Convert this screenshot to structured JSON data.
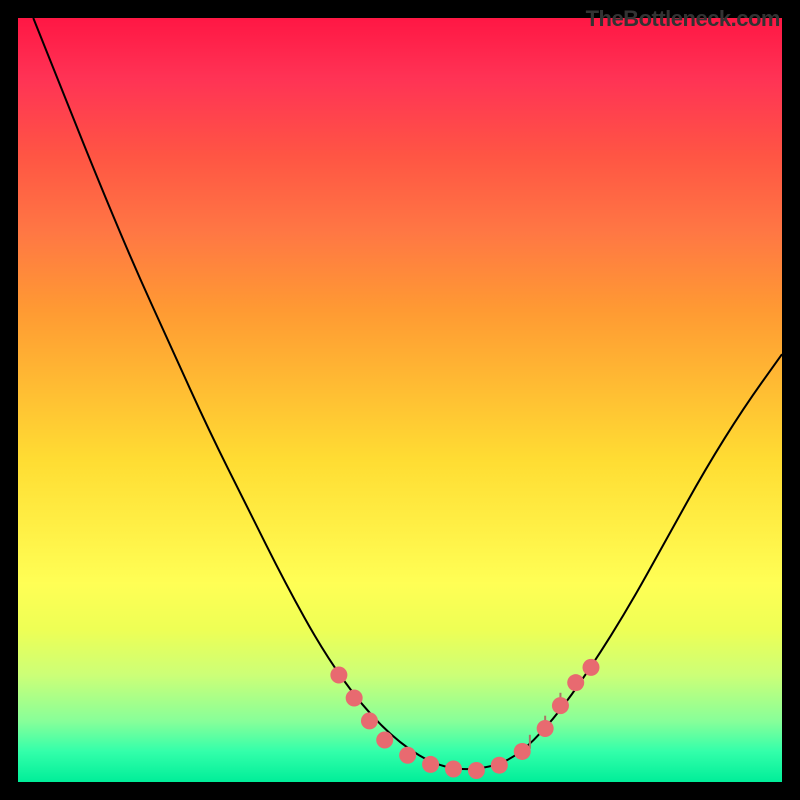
{
  "watermark": "TheBottleneck.com",
  "chart_data": {
    "type": "line",
    "title": "",
    "xlabel": "",
    "ylabel": "",
    "xlim": [
      0,
      100
    ],
    "ylim": [
      0,
      100
    ],
    "curve": {
      "name": "bottleneck-curve",
      "points": [
        {
          "x": 2,
          "y": 100
        },
        {
          "x": 6,
          "y": 90
        },
        {
          "x": 10,
          "y": 80
        },
        {
          "x": 15,
          "y": 68
        },
        {
          "x": 20,
          "y": 57
        },
        {
          "x": 25,
          "y": 46
        },
        {
          "x": 30,
          "y": 36
        },
        {
          "x": 35,
          "y": 26
        },
        {
          "x": 40,
          "y": 17
        },
        {
          "x": 45,
          "y": 10
        },
        {
          "x": 50,
          "y": 5
        },
        {
          "x": 55,
          "y": 2
        },
        {
          "x": 60,
          "y": 1.5
        },
        {
          "x": 65,
          "y": 3
        },
        {
          "x": 70,
          "y": 8
        },
        {
          "x": 75,
          "y": 15
        },
        {
          "x": 80,
          "y": 23
        },
        {
          "x": 85,
          "y": 32
        },
        {
          "x": 90,
          "y": 41
        },
        {
          "x": 95,
          "y": 49
        },
        {
          "x": 100,
          "y": 56
        }
      ]
    },
    "markers": {
      "name": "highlight-dots",
      "color": "#e86a70",
      "points": [
        {
          "x": 42,
          "y": 14
        },
        {
          "x": 44,
          "y": 11
        },
        {
          "x": 46,
          "y": 8
        },
        {
          "x": 48,
          "y": 5.5
        },
        {
          "x": 51,
          "y": 3.5
        },
        {
          "x": 54,
          "y": 2.3
        },
        {
          "x": 57,
          "y": 1.7
        },
        {
          "x": 60,
          "y": 1.5
        },
        {
          "x": 63,
          "y": 2.2
        },
        {
          "x": 66,
          "y": 4
        },
        {
          "x": 69,
          "y": 7
        },
        {
          "x": 71,
          "y": 10
        },
        {
          "x": 73,
          "y": 13
        },
        {
          "x": 75,
          "y": 15
        }
      ]
    },
    "ticks": {
      "name": "fine-ticks",
      "color": "#aa7766",
      "points": [
        {
          "x": 67,
          "y": 5
        },
        {
          "x": 69,
          "y": 7.5
        },
        {
          "x": 71,
          "y": 10.5
        }
      ]
    }
  }
}
